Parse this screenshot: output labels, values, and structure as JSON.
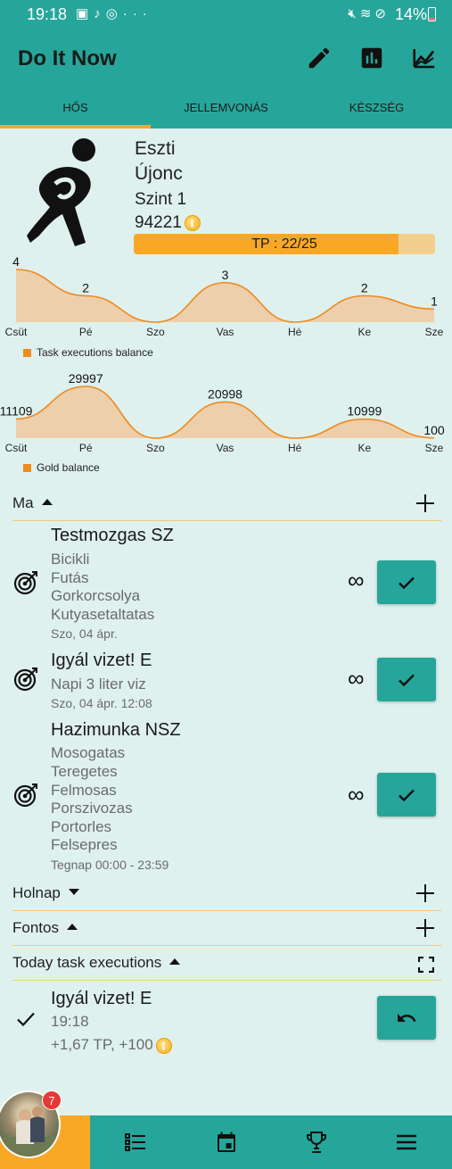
{
  "status_bar": {
    "time": "19:18",
    "battery": "14%",
    "left_icons": [
      "image-icon",
      "notification-icon",
      "messenger-icon",
      "more-icon"
    ],
    "right_icons": [
      "mute-icon",
      "wifi-icon",
      "dnd-icon"
    ]
  },
  "app": {
    "title": "Do It Now",
    "actions": [
      "edit-icon",
      "bar-chart-icon",
      "line-chart-icon"
    ]
  },
  "tabs": [
    {
      "label": "HŐS",
      "active": true
    },
    {
      "label": "JELLEMVONÁS",
      "active": false
    },
    {
      "label": "KÉSZSÉG",
      "active": false
    }
  ],
  "hero": {
    "name": "Eszti",
    "rank": "Újonc",
    "level": "Szint 1",
    "gold": "94221",
    "tp_label": "TP : 22/25",
    "tp_fraction": 0.88
  },
  "chart_data": [
    {
      "type": "area",
      "categories": [
        "Csüt",
        "Pé",
        "Szo",
        "Vas",
        "Hé",
        "Ke",
        "Sze"
      ],
      "series": [
        {
          "name": "Task executions balance",
          "values": [
            4,
            2,
            0,
            3,
            0,
            2,
            1
          ]
        }
      ],
      "color": "#ef8a1d"
    },
    {
      "type": "area",
      "categories": [
        "Csüt",
        "Pé",
        "Szo",
        "Vas",
        "Hé",
        "Ke",
        "Sze"
      ],
      "series": [
        {
          "name": "Gold balance",
          "values": [
            11109,
            29997,
            0,
            20998,
            0,
            10999,
            100
          ]
        }
      ],
      "color": "#ef8a1d"
    }
  ],
  "sections": {
    "today": "Ma",
    "tomorrow": "Holnap",
    "important": "Fontos",
    "executions": "Today task executions"
  },
  "today_tasks": [
    {
      "title": "Testmozgas SZ",
      "subtasks": [
        "Bicikli",
        "Futás",
        "Gorkorcsolya",
        "Kutyasetaltatas"
      ],
      "date": "Szo, 04 ápr.",
      "repeat": "∞"
    },
    {
      "title": "Igyál vizet! E",
      "subtasks": [
        "Napi 3 liter viz"
      ],
      "date": "Szo, 04 ápr. 12:08",
      "repeat": "∞"
    },
    {
      "title": "Hazimunka NSZ",
      "subtasks": [
        "Mosogatas",
        "Teregetes",
        "Felmosas",
        "Porszivozas",
        "Portorles",
        "Felsepres"
      ],
      "date": "Tegnap 00:00 - 23:59",
      "repeat": "∞"
    }
  ],
  "execution": {
    "title": "Igyál vizet! E",
    "time": "19:18",
    "reward": "+1,67 TP, +100"
  },
  "bottom_nav": {
    "badge": "7",
    "items": [
      "profile-tab",
      "list-icon",
      "calendar-icon",
      "trophy-icon",
      "menu-icon"
    ]
  },
  "colors": {
    "primary": "#26a69a",
    "accent": "#f9a825",
    "chart": "#ef8a1d",
    "background": "#dff1ee"
  }
}
